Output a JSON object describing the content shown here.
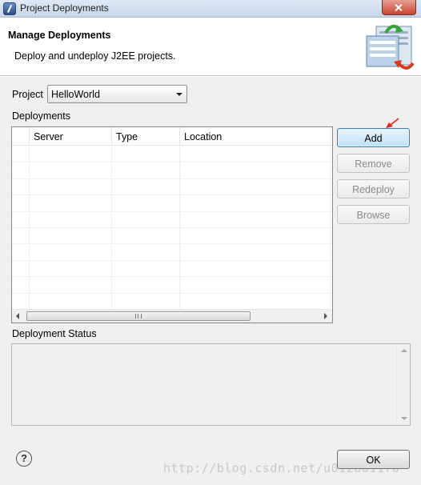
{
  "window": {
    "title": "Project Deployments"
  },
  "banner": {
    "title": "Manage Deployments",
    "description": "Deploy and undeploy J2EE projects.",
    "icon": "deployment-server-icon"
  },
  "project": {
    "label": "Project",
    "selected": "HelloWorld"
  },
  "deployments": {
    "label": "Deployments",
    "columns": [
      "",
      "Server",
      "Type",
      "Location"
    ],
    "rows": [],
    "empty_row_count": 10
  },
  "buttons": {
    "add": "Add",
    "remove": "Remove",
    "redeploy": "Redeploy",
    "browse": "Browse",
    "ok": "OK"
  },
  "status": {
    "label": "Deployment Status",
    "text": ""
  },
  "help_icon": "help-icon",
  "watermark": "http://blog.csdn.net/u012861170",
  "colors": {
    "annotation_arrow": "#e8241b",
    "primary_button": "#bfe1f7"
  }
}
